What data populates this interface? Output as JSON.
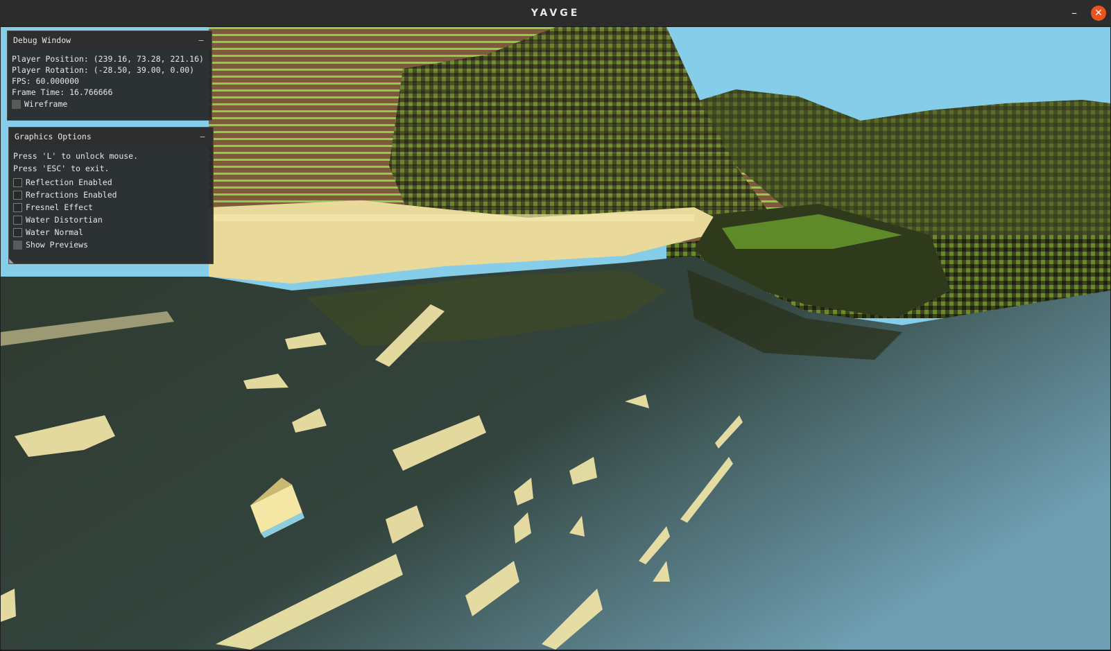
{
  "window": {
    "title": "YAVGE",
    "minimize_glyph": "–",
    "close_glyph": "✕",
    "close_color": "#e9541f"
  },
  "debug": {
    "title": "Debug Window",
    "collapse_glyph": "–",
    "player_position": "Player Position: (239.16, 73.28, 221.16)",
    "player_rotation": "Player Rotation: (-28.50, 39.00, 0.00)",
    "fps": "FPS: 60.000000",
    "frame_time": "Frame Time: 16.766666",
    "wireframe_label": "Wireframe"
  },
  "graphics": {
    "title": "Graphics Options",
    "collapse_glyph": "–",
    "hint_unlock": "Press 'L' to unlock mouse.",
    "hint_exit": "Press 'ESC' to exit.",
    "options": [
      {
        "label": "Reflection Enabled",
        "checked": false
      },
      {
        "label": "Refractions Enabled",
        "checked": false
      },
      {
        "label": "Fresnel Effect",
        "checked": false
      },
      {
        "label": "Water Distortian",
        "checked": false
      },
      {
        "label": "Water Normal",
        "checked": false
      },
      {
        "label": "Show Previews",
        "checked": true
      }
    ]
  },
  "scene": {
    "sky_color": "#87ceeb",
    "grass_color": "#7fbf3f",
    "dirt_color": "#8a6442",
    "sand_color": "#f3e7a6",
    "water_near_color": "#2b3a30",
    "water_far_color": "#6f9fb3"
  }
}
